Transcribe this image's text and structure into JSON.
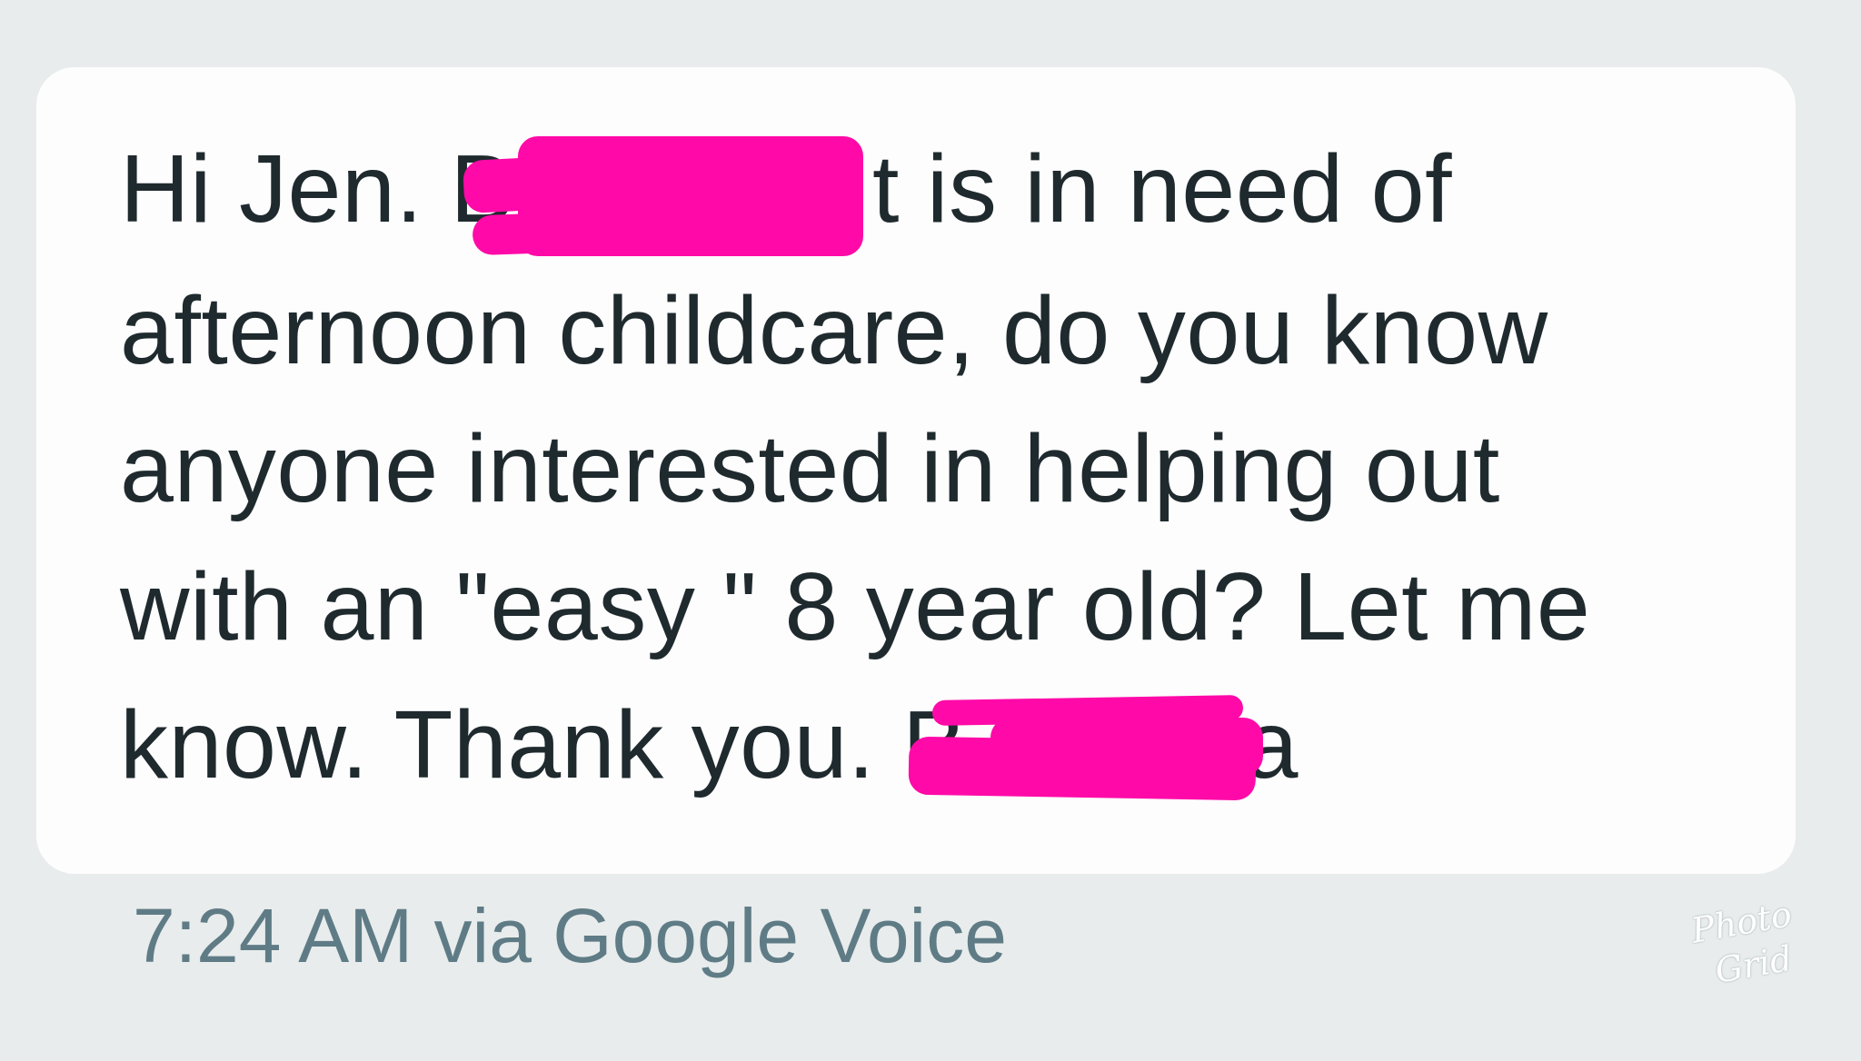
{
  "message": {
    "lines": [
      "Hi Jen. B",
      "t is in need of",
      "afternoon childcare, do you know",
      "anyone interested in helping out",
      "with an \"easy \" 8 year old? Let me",
      "know. Thank you. B",
      "da"
    ],
    "redaction_color": "#ff0aa8"
  },
  "meta": {
    "timestamp": "7:24 AM via Google Voice"
  },
  "watermark": {
    "line1": "Photo",
    "line2": "Grid"
  },
  "colors": {
    "background": "#e8ecec",
    "bubble": "#fdfdfd",
    "text": "#1f2a2e",
    "timestamp": "#5f7c86"
  }
}
